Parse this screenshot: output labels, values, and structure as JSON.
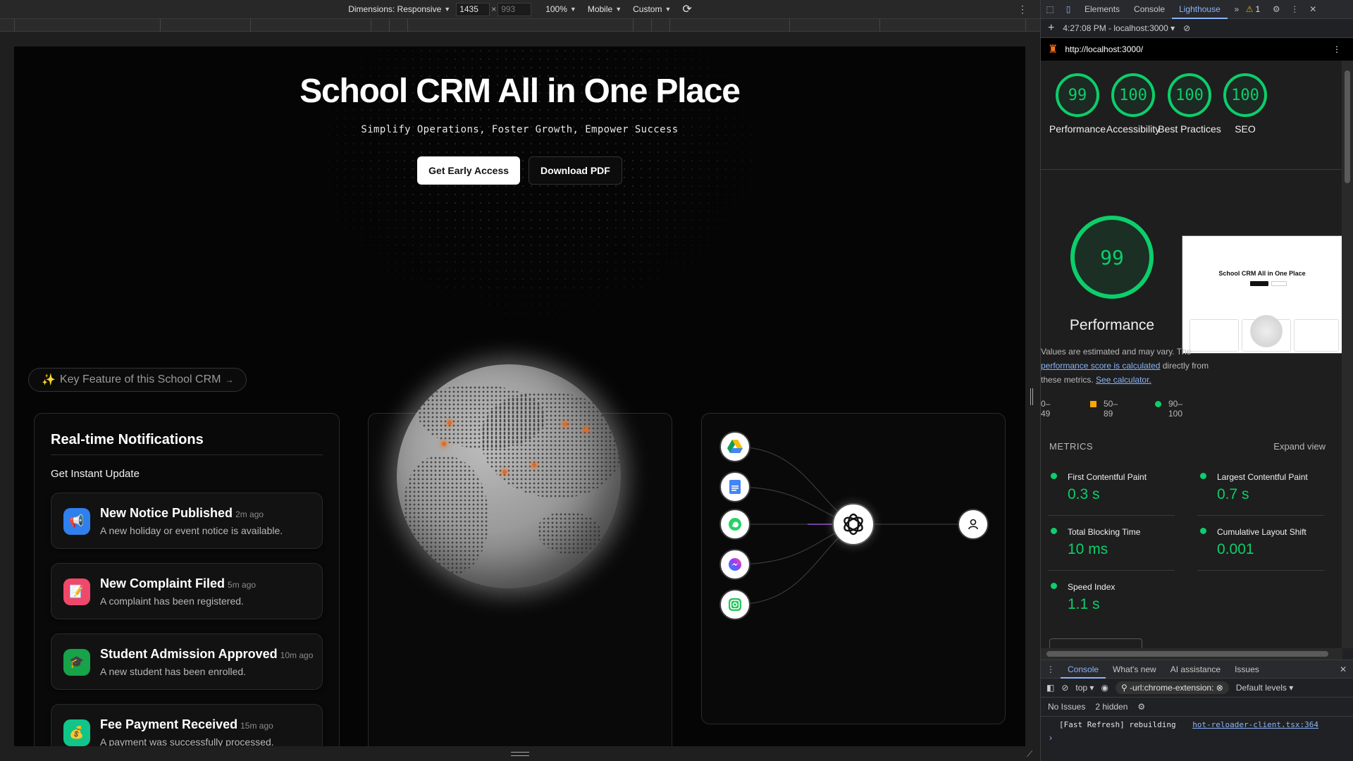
{
  "device_toolbar": {
    "dimensions_label": "Dimensions: Responsive",
    "width": "1435",
    "height": "993",
    "zoom": "100%",
    "device": "Mobile",
    "throttle": "Custom"
  },
  "hero": {
    "title": "School CRM All in One Place",
    "subtitle": "Simplify Operations, Foster Growth, Empower Success",
    "primary_cta": "Get Early Access",
    "secondary_cta": "Download PDF"
  },
  "feature_pill": {
    "icon": "✨",
    "label": "Key Feature of this School CRM",
    "arrow": "→"
  },
  "notifications_card": {
    "title": "Real-time Notifications",
    "subtitle": "Get Instant Update",
    "items": [
      {
        "title": "New Notice Published",
        "time": "2m ago",
        "desc": "A new holiday or event notice is available.",
        "icon": "megaphone-icon",
        "glyph": "📢",
        "color": "#2f80ed"
      },
      {
        "title": "New Complaint Filed",
        "time": "5m ago",
        "desc": "A complaint has been registered.",
        "icon": "memo-icon",
        "glyph": "📝",
        "color": "#f0486b"
      },
      {
        "title": "Student Admission Approved",
        "time": "10m ago",
        "desc": "A new student has been enrolled.",
        "icon": "graduation-cap-icon",
        "glyph": "🎓",
        "color": "#16a34a"
      },
      {
        "title": "Fee Payment Received",
        "time": "15m ago",
        "desc": "A payment was successfully processed.",
        "icon": "money-bag-icon",
        "glyph": "💰",
        "color": "#10c48a"
      }
    ]
  },
  "integrations": {
    "sources": [
      "google-drive-icon",
      "google-docs-icon",
      "whatsapp-icon",
      "messenger-icon",
      "instagram-icon"
    ],
    "hub": "openai-icon",
    "target": "user-icon"
  },
  "devtools": {
    "tabs": [
      "Elements",
      "Console",
      "Lighthouse"
    ],
    "active_tab": "Lighthouse",
    "warning_count": "1",
    "report_time": "4:27:08 PM - localhost:3000",
    "url": "http://localhost:3000/",
    "scores": [
      {
        "value": "99",
        "label": "Performance"
      },
      {
        "value": "100",
        "label": "Accessibility"
      },
      {
        "value": "100",
        "label": "Best Practices"
      },
      {
        "value": "100",
        "label": "SEO"
      }
    ],
    "main_score": "99",
    "main_label": "Performance",
    "disclaimer_pre": "Values are estimated and may vary. The ",
    "disclaimer_link": "performance score is calculated",
    "disclaimer_mid": " directly from these metrics. ",
    "disclaimer_link2": "See calculator.",
    "legend": {
      "low": "0–49",
      "mid": "50–89",
      "high": "90–100"
    },
    "metrics_heading": "METRICS",
    "expand_view": "Expand view",
    "metrics": [
      {
        "name": "First Contentful Paint",
        "value": "0.3 s"
      },
      {
        "name": "Largest Contentful Paint",
        "value": "0.7 s"
      },
      {
        "name": "Total Blocking Time",
        "value": "10 ms"
      },
      {
        "name": "Cumulative Layout Shift",
        "value": "0.001"
      },
      {
        "name": "Speed Index",
        "value": "1.1 s"
      }
    ],
    "thumb_title": "School CRM All in One Place",
    "drawer_tabs": [
      "Console",
      "What's new",
      "AI assistance",
      "Issues"
    ],
    "context": "top",
    "filter": "-url:chrome-extension:",
    "levels": "Default levels",
    "no_issues": "No Issues",
    "hidden": "2 hidden",
    "log_message": "[Fast Refresh] rebuilding",
    "log_source": "hot-reloader-client.tsx:364"
  },
  "colors": {
    "good": "#0cce6b",
    "average": "#ffa400",
    "link": "#8ab4f8"
  }
}
